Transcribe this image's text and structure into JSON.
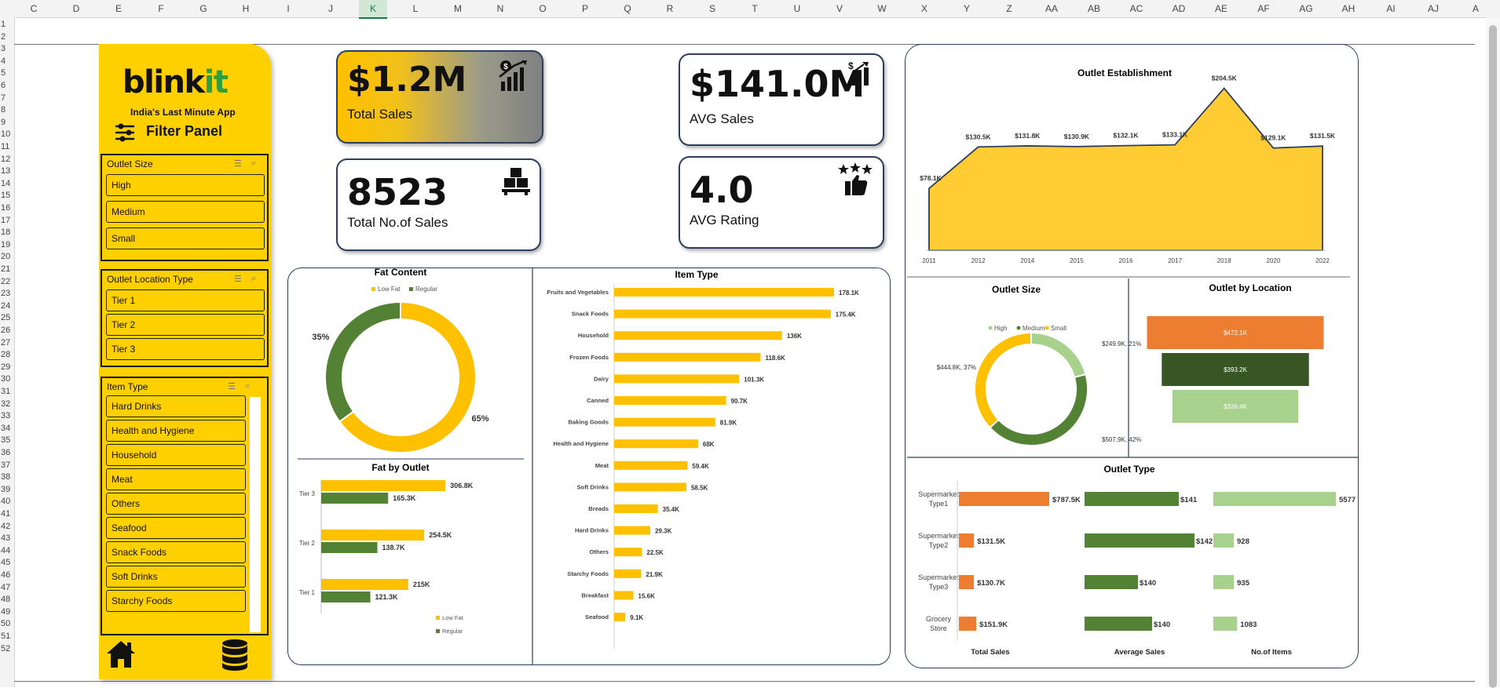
{
  "spreadsheet": {
    "columns": [
      "C",
      "D",
      "E",
      "F",
      "G",
      "H",
      "I",
      "J",
      "K",
      "L",
      "M",
      "N",
      "O",
      "P",
      "Q",
      "R",
      "S",
      "T",
      "U",
      "V",
      "W",
      "X",
      "Y",
      "Z",
      "AA",
      "AB",
      "AC",
      "AD",
      "AE",
      "AF",
      "AG",
      "AH",
      "AI",
      "AJ",
      "A"
    ],
    "selected_column": "K",
    "rows": [
      "1",
      "2",
      "3",
      "4",
      "5",
      "6",
      "7",
      "8",
      "9",
      "10",
      "11",
      "12",
      "13",
      "14",
      "15",
      "16",
      "17",
      "18",
      "19",
      "20",
      "21",
      "22",
      "23",
      "24",
      "25",
      "26",
      "27",
      "28",
      "29",
      "30",
      "31",
      "32",
      "33",
      "34",
      "35",
      "36",
      "37",
      "38",
      "39",
      "40",
      "41",
      "42",
      "43",
      "44",
      "45",
      "46",
      "47",
      "48",
      "49",
      "50",
      "51",
      "52"
    ]
  },
  "sidebar": {
    "logo_main": "blink",
    "logo_accent": "it",
    "tagline": "India's Last Minute App",
    "filter_panel_label": "Filter Panel",
    "outlet_size": {
      "title": "Outlet Size",
      "items": [
        "High",
        "Medium",
        "Small"
      ]
    },
    "outlet_location": {
      "title": "Outlet Location Type",
      "items": [
        "Tier 1",
        "Tier 2",
        "Tier 3"
      ]
    },
    "item_type": {
      "title": "Item Type",
      "items": [
        "Hard Drinks",
        "Health and Hygiene",
        "Household",
        "Meat",
        "Others",
        "Seafood",
        "Snack Foods",
        "Soft Drinks",
        "Starchy Foods"
      ]
    }
  },
  "kpis": {
    "total_sales": {
      "value": "$1.2M",
      "label": "Total Sales"
    },
    "avg_sales": {
      "value": "$141.0M",
      "label": "AVG Sales"
    },
    "total_count": {
      "value": "8523",
      "label": "Total No.of Sales"
    },
    "avg_rating": {
      "value": "4.0",
      "label": "AVG Rating"
    }
  },
  "colors": {
    "yellow": "#ffc000",
    "yellow_light": "#ffd23f",
    "dark_green": "#548235",
    "deep_green": "#375623",
    "light_green": "#a9d18e",
    "orange": "#ed7d31",
    "navy": "#2c3e5c"
  },
  "chart_data": [
    {
      "id": "fat_content",
      "type": "pie",
      "title": "Fat Content",
      "legend": [
        "Low Fat",
        "Regular"
      ],
      "labels": [
        "Low Fat",
        "Regular"
      ],
      "values": [
        65,
        35
      ],
      "value_labels": [
        "65%",
        "35%"
      ]
    },
    {
      "id": "fat_by_outlet",
      "type": "bar",
      "title": "Fat by Outlet",
      "categories": [
        "Tier 3",
        "Tier 2",
        "Tier 1"
      ],
      "series": [
        {
          "name": "Low Fat",
          "values": [
            306.8,
            254.5,
            215.0
          ],
          "labels": [
            "306.8K",
            "254.5K",
            "215K"
          ]
        },
        {
          "name": "Regular",
          "values": [
            165.3,
            138.7,
            121.3
          ],
          "labels": [
            "165.3K",
            "138.7K",
            "121.3K"
          ]
        }
      ]
    },
    {
      "id": "item_type",
      "type": "bar",
      "title": "Item Type",
      "categories": [
        "Fruits and Vegetables",
        "Snack Foods",
        "Household",
        "Frozen Foods",
        "Dairy",
        "Canned",
        "Baking Goods",
        "Health and Hygiene",
        "Meat",
        "Soft Drinks",
        "Breads",
        "Hard Drinks",
        "Others",
        "Starchy Foods",
        "Breakfast",
        "Seafood"
      ],
      "values": [
        178.1,
        175.4,
        136.0,
        118.6,
        101.3,
        90.7,
        81.9,
        68.0,
        59.4,
        58.5,
        35.4,
        29.3,
        22.5,
        21.9,
        15.6,
        9.1
      ],
      "labels": [
        "178.1K",
        "175.4K",
        "136K",
        "118.6K",
        "101.3K",
        "90.7K",
        "81.9K",
        "68K",
        "59.4K",
        "58.5K",
        "35.4K",
        "29.3K",
        "22.5K",
        "21.9K",
        "15.6K",
        "9.1K"
      ]
    },
    {
      "id": "outlet_establishment",
      "type": "area",
      "title": "Outlet Establishment",
      "x": [
        "2011",
        "2012",
        "2014",
        "2015",
        "2016",
        "2017",
        "2018",
        "2020",
        "2022"
      ],
      "values": [
        78.1,
        130.5,
        131.8,
        130.9,
        132.1,
        133.1,
        204.5,
        129.1,
        131.5
      ],
      "labels": [
        "$78.1K",
        "$130.5K",
        "$131.8K",
        "$130.9K",
        "$132.1K",
        "$133.1K",
        "$204.5K",
        "$129.1K",
        "$131.5K"
      ],
      "ylim": [
        0,
        210
      ]
    },
    {
      "id": "outlet_size",
      "type": "pie",
      "title": "Outlet Size",
      "legend": [
        "High",
        "Medium",
        "Small"
      ],
      "labels": [
        "High",
        "Medium",
        "Small"
      ],
      "values": [
        249.9,
        507.9,
        444.8
      ],
      "value_labels": [
        "$249.9K, 21%",
        "$507.9K, 42%",
        "$444.8K, 37%"
      ]
    },
    {
      "id": "outlet_by_location",
      "type": "bar",
      "title": "Outlet by Location",
      "values": [
        472.1,
        393.2,
        336.4
      ],
      "labels": [
        "$472.1K",
        "$393.2K",
        "$336.4K"
      ]
    },
    {
      "id": "outlet_type",
      "type": "table",
      "title": "Outlet Type",
      "rows": [
        "Supermarket Type1",
        "Supermarket Type2",
        "Supermarket Type3",
        "Grocery Store"
      ],
      "columns": [
        "Total Sales",
        "Average Sales",
        "No.of Items"
      ],
      "total_sales": [
        787.5,
        131.5,
        130.7,
        151.9
      ],
      "total_sales_labels": [
        "$787.5K",
        "$131.5K",
        "$130.7K",
        "$151.9K"
      ],
      "avg_sales": [
        141,
        142,
        140,
        140
      ],
      "avg_sales_labels": [
        "$141",
        "$142",
        "$140",
        "$140"
      ],
      "items": [
        5577,
        928,
        935,
        1083
      ],
      "items_labels": [
        "5577",
        "928",
        "935",
        "1083"
      ]
    }
  ]
}
